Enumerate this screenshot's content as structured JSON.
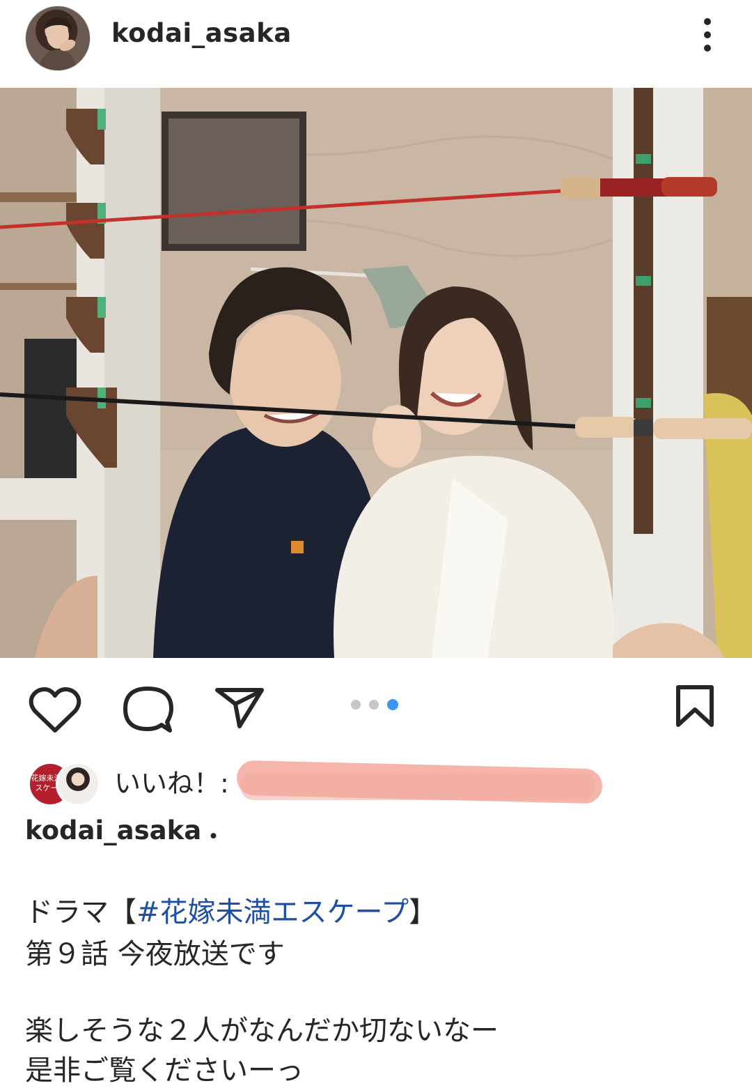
{
  "post": {
    "username": "kodai_asaka",
    "more_icon": "more-vertical-icon"
  },
  "carousel": {
    "count": 3,
    "active_index": 2,
    "colors": {
      "inactive": "#c7c7c7",
      "active": "#3897f0"
    }
  },
  "actions": {
    "icons": [
      "heart-icon",
      "comment-icon",
      "send-icon",
      "bookmark-icon"
    ]
  },
  "likes": {
    "label": "いいね！:",
    "avatar1_text": "花嫁未満エスケープ"
  },
  "caption": {
    "username": "kodai_asaka",
    "separator": "・",
    "line1_prefix": "ドラマ【",
    "line1_hashtag": "#花嫁未満エスケープ",
    "line1_suffix": "】",
    "line2": "第９話 今夜放送です",
    "line3": "楽しそうな２人がなんだか切ないなー",
    "line4": "是非ご覧くださいーっ"
  },
  "colors": {
    "hashtag": "#1e4fa0",
    "redaction": "#f5b5ab"
  }
}
